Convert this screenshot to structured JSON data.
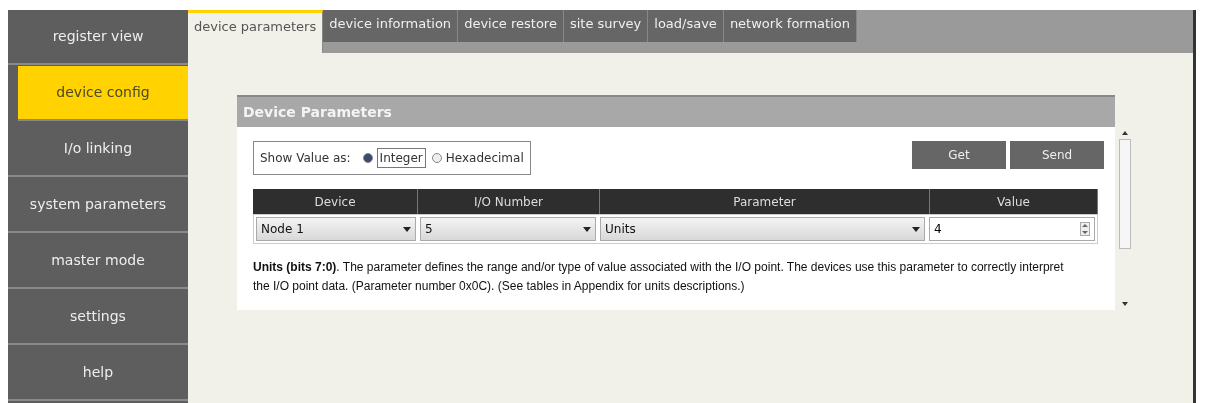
{
  "sidebar": {
    "items": [
      {
        "label": "register view",
        "selected": false
      },
      {
        "label": "device config",
        "selected": true
      },
      {
        "label": "I/o linking",
        "selected": false
      },
      {
        "label": "system parameters",
        "selected": false
      },
      {
        "label": "master mode",
        "selected": false
      },
      {
        "label": "settings",
        "selected": false
      },
      {
        "label": "help",
        "selected": false
      }
    ]
  },
  "tabs": [
    {
      "label": "device parameters",
      "selected": true
    },
    {
      "label": "device information",
      "selected": false
    },
    {
      "label": "device restore",
      "selected": false
    },
    {
      "label": "site survey",
      "selected": false
    },
    {
      "label": "load/save",
      "selected": false
    },
    {
      "label": "network formation",
      "selected": false
    }
  ],
  "panel": {
    "title": "Device Parameters",
    "show_value": {
      "label": "Show Value as:",
      "options": [
        {
          "label": "Integer",
          "selected": true
        },
        {
          "label": "Hexadecimal",
          "selected": false
        }
      ]
    },
    "buttons": [
      "Get",
      "Send"
    ],
    "table": {
      "columns": [
        "Device",
        "I/O Number",
        "Parameter",
        "Value"
      ],
      "row": {
        "device": "Node 1",
        "io_number": "5",
        "parameter": "Units",
        "value": "4"
      }
    },
    "description": "**Units (bits 7:0)**. The parameter defines the range and/or type of value associated with the I/O point. The devices use this parameter to correctly interpret the I/O point data. (Parameter number 0x0C). (See tables in Appendix for units descriptions.)"
  }
}
